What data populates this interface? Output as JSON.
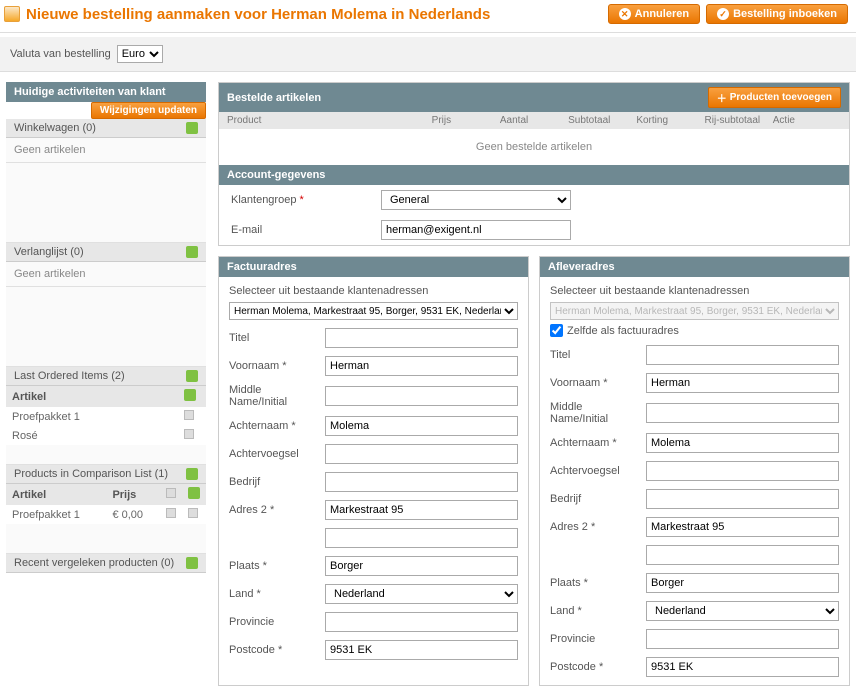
{
  "header": {
    "title": "Nieuwe bestelling aanmaken voor Herman Molema in Nederlands",
    "cancel": "Annuleren",
    "submit": "Bestelling inboeken"
  },
  "currency": {
    "label": "Valuta van bestelling",
    "value": "Euro"
  },
  "sidebar": {
    "activities_title": "Huidige activiteiten van klant",
    "update_btn": "Wijzigingen updaten",
    "cart_title": "Winkelwagen (0)",
    "no_items": "Geen artikelen",
    "wishlist_title": "Verlanglijst (0)",
    "last_ordered_title": "Last Ordered Items (2)",
    "col_article": "Artikel",
    "col_price": "Prijs",
    "item1": "Proefpakket 1",
    "item2": "Rosé",
    "item1_price": "€ 0,00",
    "compare_title": "Products in Comparison List (1)",
    "recent_title": "Recent vergeleken producten (0)"
  },
  "ordered": {
    "title": "Bestelde artikelen",
    "add_btn": "Producten toevoegen",
    "col_product": "Product",
    "col_price": "Prijs",
    "col_qty": "Aantal",
    "col_subtotal": "Subtotaal",
    "col_discount": "Korting",
    "col_row_subtotal": "Rij-subtotaal",
    "col_action": "Actie",
    "empty": "Geen bestelde artikelen"
  },
  "account": {
    "title": "Account-gegevens",
    "group_label": "Klantengroep",
    "group_value": "General",
    "email_label": "E-mail",
    "email_value": "herman@exigent.nl"
  },
  "billing": {
    "title": "Factuuradres",
    "select_label": "Selecteer uit bestaande klantenadressen",
    "select_value": "Herman Molema, Markestraat 95, Borger, 9531 EK, Nederlan"
  },
  "shipping": {
    "title": "Afleveradres",
    "select_label": "Selecteer uit bestaande klantenadressen",
    "select_value": "Herman Molema, Markestraat 95, Borger, 9531 EK, Nederlan",
    "same_as": "Zelfde als factuuradres"
  },
  "fields": {
    "title": "Titel",
    "firstname": "Voornaam",
    "middle": "Middle Name/Initial",
    "lastname": "Achternaam",
    "suffix": "Achtervoegsel",
    "company": "Bedrijf",
    "address2": "Adres 2",
    "city": "Plaats",
    "country": "Land",
    "province": "Provincie",
    "postcode": "Postcode"
  },
  "values": {
    "firstname": "Herman",
    "lastname": "Molema",
    "address2": "Markestraat 95",
    "city": "Borger",
    "country": "Nederland",
    "postcode": "9531 EK"
  }
}
